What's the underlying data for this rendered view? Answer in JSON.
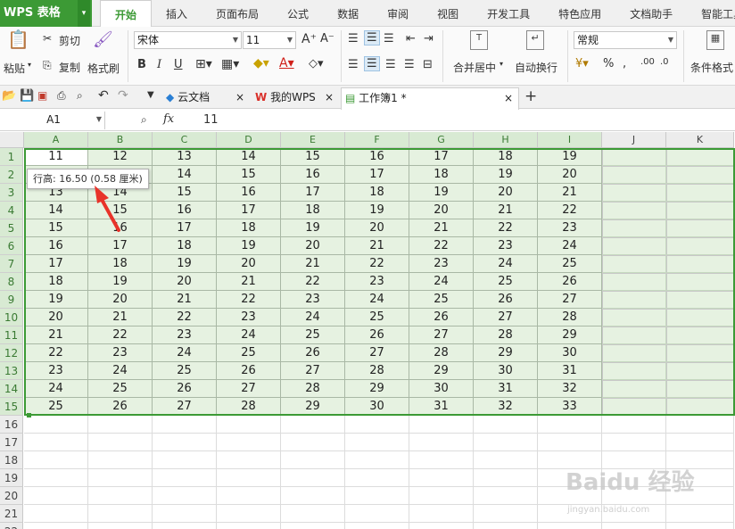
{
  "app": {
    "logo": "WPS 表格",
    "caret": "▾"
  },
  "menu_tabs": [
    "开始",
    "插入",
    "页面布局",
    "公式",
    "数据",
    "审阅",
    "视图",
    "开发工具",
    "特色应用",
    "文档助手",
    "智能工具箱"
  ],
  "ribbon": {
    "paste": "粘贴",
    "cut": "剪切",
    "copy": "复制",
    "format_painter": "格式刷",
    "font_name": "宋体",
    "font_size": "11",
    "merge_center": "合并居中",
    "wrap_text": "自动换行",
    "number_format": "常规",
    "conditional_format": "条件格式",
    "bold": "B",
    "italic": "I",
    "underline": "U"
  },
  "doc_tabs": [
    {
      "label": "云文档"
    },
    {
      "label": "我的WPS"
    },
    {
      "label": "工作簿1 *"
    }
  ],
  "formula_bar": {
    "cell_ref": "A1",
    "fx": "fx",
    "value": "11"
  },
  "columns": [
    "A",
    "B",
    "C",
    "D",
    "E",
    "F",
    "G",
    "H",
    "I",
    "J",
    "K"
  ],
  "rows": [
    "1",
    "2",
    "3",
    "4",
    "5",
    "6",
    "7",
    "8",
    "9",
    "10",
    "11",
    "12",
    "13",
    "14",
    "15",
    "16",
    "17",
    "18",
    "19",
    "20",
    "21",
    "22"
  ],
  "cells": [
    [
      "11",
      "12",
      "13",
      "14",
      "15",
      "16",
      "17",
      "18",
      "19"
    ],
    [
      "12",
      "13",
      "14",
      "15",
      "16",
      "17",
      "18",
      "19",
      "20"
    ],
    [
      "13",
      "14",
      "15",
      "16",
      "17",
      "18",
      "19",
      "20",
      "21"
    ],
    [
      "14",
      "15",
      "16",
      "17",
      "18",
      "19",
      "20",
      "21",
      "22"
    ],
    [
      "15",
      "16",
      "17",
      "18",
      "19",
      "20",
      "21",
      "22",
      "23"
    ],
    [
      "16",
      "17",
      "18",
      "19",
      "20",
      "21",
      "22",
      "23",
      "24"
    ],
    [
      "17",
      "18",
      "19",
      "20",
      "21",
      "22",
      "23",
      "24",
      "25"
    ],
    [
      "18",
      "19",
      "20",
      "21",
      "22",
      "23",
      "24",
      "25",
      "26"
    ],
    [
      "19",
      "20",
      "21",
      "22",
      "23",
      "24",
      "25",
      "26",
      "27"
    ],
    [
      "20",
      "21",
      "22",
      "23",
      "24",
      "25",
      "26",
      "27",
      "28"
    ],
    [
      "21",
      "22",
      "23",
      "24",
      "25",
      "26",
      "27",
      "28",
      "29"
    ],
    [
      "22",
      "23",
      "24",
      "25",
      "26",
      "27",
      "28",
      "29",
      "30"
    ],
    [
      "23",
      "24",
      "25",
      "26",
      "27",
      "28",
      "29",
      "30",
      "31"
    ],
    [
      "24",
      "25",
      "26",
      "27",
      "28",
      "29",
      "30",
      "31",
      "32"
    ],
    [
      "25",
      "26",
      "27",
      "28",
      "29",
      "30",
      "31",
      "32",
      "33"
    ]
  ],
  "tooltip": "行高: 16.50 (0.58 厘米)",
  "watermark": "Baidu 经验",
  "watermark_url": "jingyan.baidu.com",
  "colors": {
    "accent": "#3c9a35",
    "selection": "#e6f2e1",
    "arrow": "#e8332a"
  }
}
